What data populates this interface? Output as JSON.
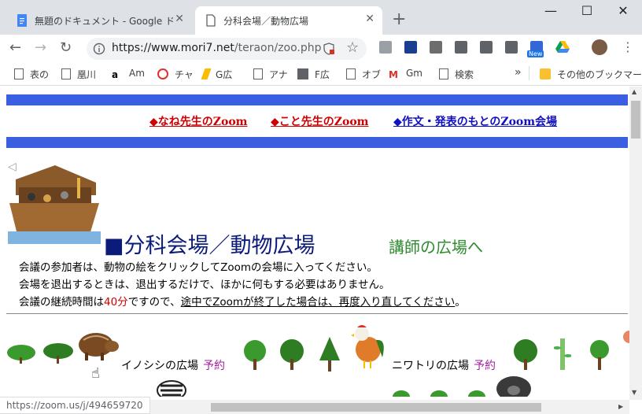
{
  "browser": {
    "tabs": [
      {
        "title": "無題のドキュメント - Google ドキュメント",
        "active": false
      },
      {
        "title": "分科会場／動物広場",
        "active": true
      }
    ],
    "new_tab_icon": "+",
    "window_controls": [
      "minimize",
      "maximize",
      "close"
    ],
    "url_scheme_host": "https://www.mori7.net",
    "url_path": "/teraon/zoo.php",
    "extension_badge": "New",
    "bookmarks": [
      {
        "label": "表の",
        "icon": "page-icon"
      },
      {
        "label": "凰川",
        "icon": "page-icon"
      },
      {
        "label": "Am",
        "icon": "amazon-icon"
      },
      {
        "label": "チャ",
        "icon": "chat-icon"
      },
      {
        "label": "G広",
        "icon": "google-ads-icon"
      },
      {
        "label": "アナ",
        "icon": "page-icon"
      },
      {
        "label": "F広",
        "icon": "image-icon"
      },
      {
        "label": "オブ",
        "icon": "page-icon"
      },
      {
        "label": "Gm",
        "icon": "gmail-icon"
      },
      {
        "label": "検索",
        "icon": "page-icon"
      }
    ],
    "bookmarks_overflow": "»",
    "other_bookmarks": "その他のブックマーク",
    "status_url": "https://zoom.us/j/494659720"
  },
  "page": {
    "nav_links": [
      {
        "label": "◆なね先生のZoom",
        "color": "#d00000"
      },
      {
        "label": "◆こと先生のZoom",
        "color": "#d00000"
      },
      {
        "label": "◆作文・発表のもとのZoom会場",
        "color": "#1010c0"
      }
    ],
    "title": "■分科会場／動物広場",
    "teacher_link": "講師の広場へ",
    "desc_line1": "会議の参加者は、動物の絵をクリックしてZoomの会場に入ってください。",
    "desc_line2": "会場を退出するときは、退出するだけで、ほかに何もする必要はありません。",
    "desc_line3_a": "会議の継続時間は",
    "desc_line3_b": "40分",
    "desc_line3_c": "ですので、",
    "desc_line3_d": "途中でZoomが終了した場合は、再度入り直してください",
    "desc_line3_e": "。",
    "rooms": [
      {
        "name": "イノシシの広場",
        "reserve": "予約"
      },
      {
        "name": "ニワトリの広場",
        "reserve": "予約"
      }
    ],
    "colors": {
      "bar": "#3a5fe0",
      "title": "#0b1b7a",
      "teacher": "#2e8b2e",
      "reserve": "#a0209a",
      "duration": "#d00000"
    }
  }
}
